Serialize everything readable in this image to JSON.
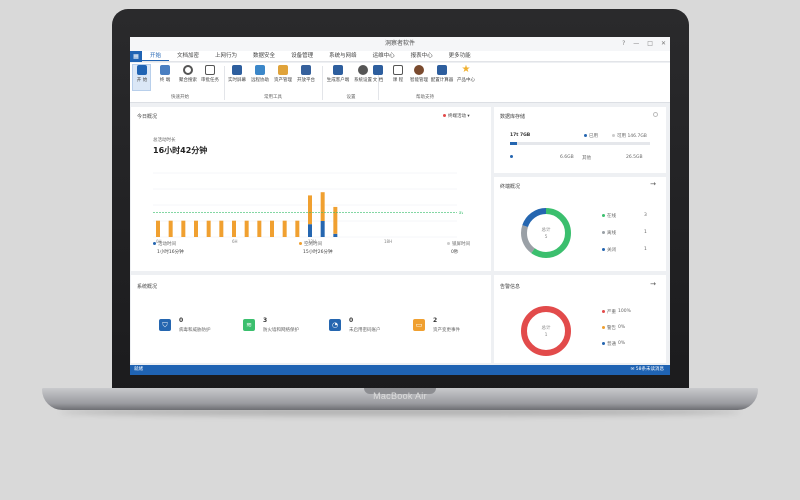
{
  "window": {
    "title": "洞察者软件"
  },
  "menu": {
    "items": [
      "开始",
      "文档加密",
      "上网行为",
      "数据安全",
      "设备管理",
      "系统与网络",
      "运维中心",
      "报表中心",
      "更多功能"
    ]
  },
  "ribbon": {
    "buttons": [
      "开 始",
      "终 端",
      "聚合搜索",
      "审批任务",
      "实时屏幕",
      "远程协助",
      "资产管理",
      "开放平台",
      "生成客户端",
      "系统设置",
      "文 档",
      "课 程",
      "智能管理",
      "配置计算器",
      "产品中心"
    ],
    "groups": [
      "快速开始",
      "常用工具",
      "设置",
      "帮助支持"
    ]
  },
  "today": {
    "title": "今日概况",
    "filter": "终端活动",
    "total_label": "总活动时长",
    "total_value": "16小时42分钟",
    "x_ticks": [
      "0H",
      "6H",
      "12H",
      "18H"
    ],
    "avg_label": "avg",
    "legend": [
      {
        "label": "活动时间",
        "value": "1小时16分钟"
      },
      {
        "label": "空闲时间",
        "value": "15小时26分钟"
      },
      {
        "label": "锁屏时间",
        "value": "0秒"
      }
    ]
  },
  "chart_data": {
    "type": "bar",
    "title": "",
    "xlabel": "",
    "ylabel": "",
    "x_ticks": [
      "0H",
      "6H",
      "12H",
      "18H"
    ],
    "series": [
      {
        "name": "活动时间",
        "values": [
          0,
          0,
          0,
          0,
          0,
          0,
          0,
          0,
          0,
          0,
          0,
          0,
          0.2,
          0.25,
          0.05,
          0,
          0,
          0,
          0,
          0,
          0,
          0,
          0,
          0
        ]
      },
      {
        "name": "空闲时间",
        "values": [
          0.85,
          0.85,
          0.85,
          0.85,
          0.85,
          0.85,
          0.85,
          0.85,
          0.85,
          0.85,
          0.85,
          0.85,
          0.75,
          0.75,
          0.7,
          0,
          0,
          0,
          0,
          0,
          0,
          0,
          0,
          0
        ]
      }
    ],
    "stacked": true,
    "avg_line": 0.38
  },
  "disk": {
    "title": "数据库存储",
    "used": "17t 7GB",
    "used_label": "已用",
    "free_label": "可用",
    "free": "146.7GB",
    "bar_used_fraction": 0.05,
    "row2_left": "6.6GB",
    "row2_label": "其他",
    "row2_right": "26.5GB"
  },
  "terminal": {
    "title": "终端概况",
    "center_label": "总计",
    "center_value": "5",
    "legend": [
      {
        "label": "在线",
        "value": "3"
      },
      {
        "label": "离线",
        "value": "1"
      },
      {
        "label": "关闭",
        "value": "1"
      }
    ]
  },
  "system": {
    "title": "系统概况",
    "items": [
      {
        "value": "0",
        "label": "病毒和威胁防护"
      },
      {
        "value": "3",
        "label": "防火墙和网络保护"
      },
      {
        "value": "0",
        "label": "未启用密码账户"
      },
      {
        "value": "2",
        "label": "资产变更事件"
      }
    ]
  },
  "alert": {
    "title": "告警信息",
    "center_label": "总计",
    "center_value": "1",
    "legend": [
      {
        "label": "严重",
        "value": "100%"
      },
      {
        "label": "警告",
        "value": "0%"
      },
      {
        "label": "普通",
        "value": "0%"
      }
    ]
  },
  "status": {
    "left": "就绪",
    "right": "58条未读消息"
  },
  "laptop": {
    "brand": "MacBook Air"
  },
  "colors": {
    "primary": "#1f63b3",
    "orange": "#f0a030",
    "green": "#3bbf6e",
    "red": "#e24b4b",
    "gray": "#9aa0a6"
  }
}
